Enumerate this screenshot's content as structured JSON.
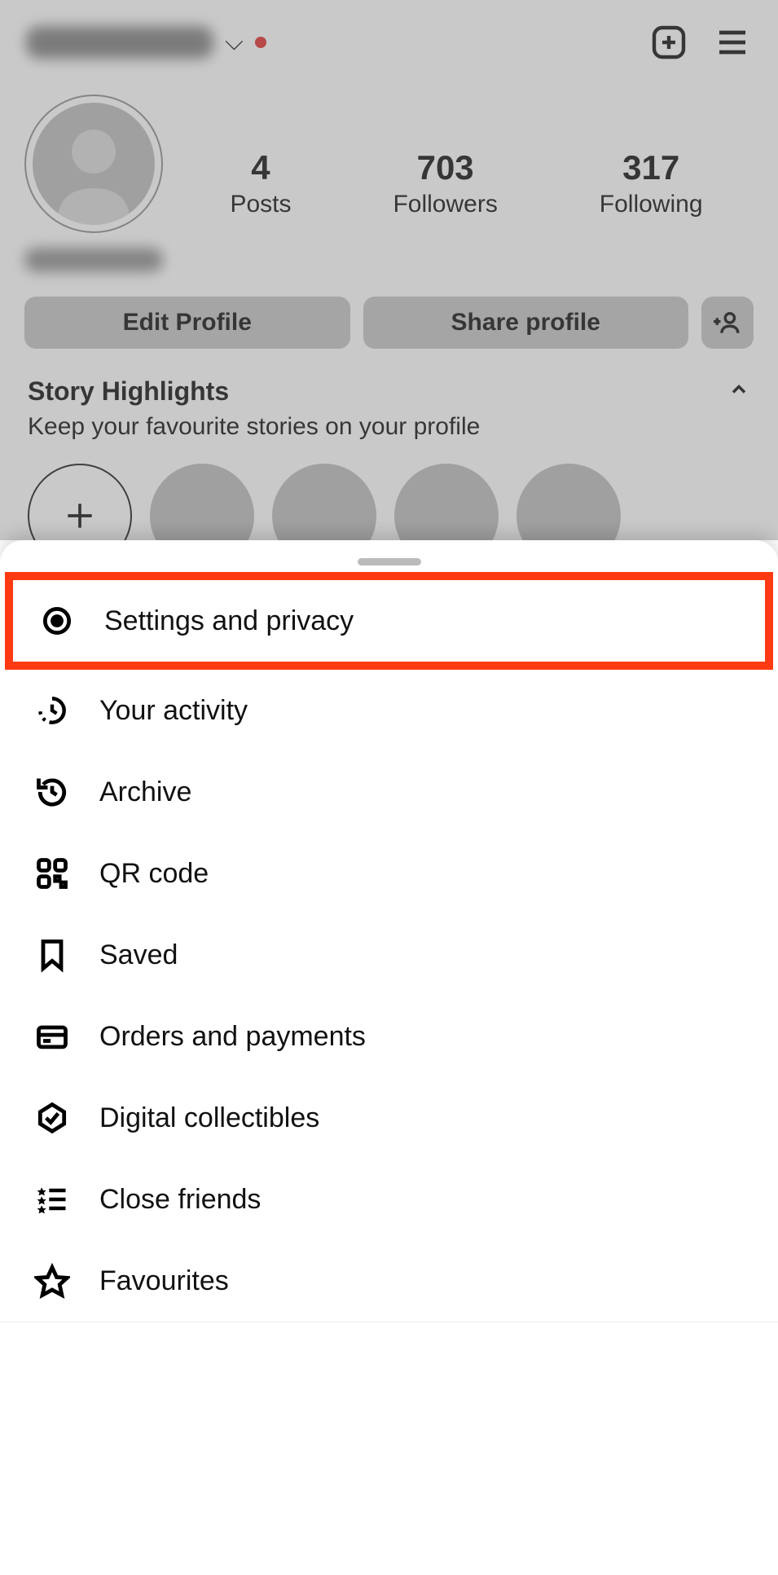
{
  "profile": {
    "stats": {
      "posts_count": "4",
      "posts_label": "Posts",
      "followers_count": "703",
      "followers_label": "Followers",
      "following_count": "317",
      "following_label": "Following"
    },
    "buttons": {
      "edit": "Edit Profile",
      "share": "Share profile"
    },
    "highlights": {
      "title": "Story Highlights",
      "subtitle": "Keep your favourite stories on your profile"
    }
  },
  "menu": {
    "items": [
      {
        "label": "Settings and privacy",
        "highlighted": true
      },
      {
        "label": "Your activity"
      },
      {
        "label": "Archive"
      },
      {
        "label": "QR code"
      },
      {
        "label": "Saved"
      },
      {
        "label": "Orders and payments"
      },
      {
        "label": "Digital collectibles"
      },
      {
        "label": "Close friends"
      },
      {
        "label": "Favourites"
      }
    ]
  }
}
